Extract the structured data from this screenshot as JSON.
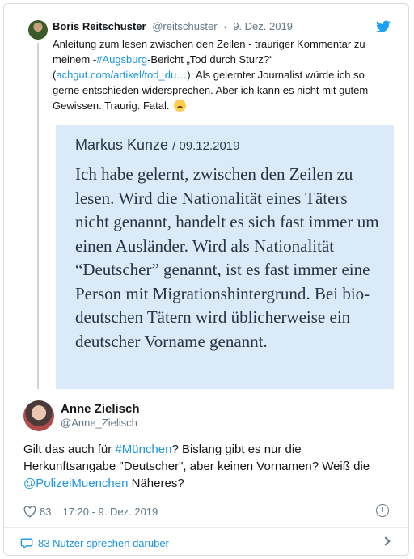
{
  "parent_tweet": {
    "name": "Boris Reitschuster",
    "handle": "@reitschuster",
    "separator": "·",
    "date": "9. Dez. 2019",
    "text_1": "Anleitung zum lesen zwischen den Zeilen - trauriger Kommentar zu meinem -",
    "hashtag": "#Augsburg",
    "text_2": "-Bericht „Tod durch Sturz?“ (",
    "link": "achgut.com/artikel/tod_du…",
    "text_3": ").  Als gelernter Journalist würde ich so gerne entschieden widersprechen. Aber ich  kann es nicht mit gutem Gewissen. Traurig. Fatal.",
    "emoji": "crying-face-icon"
  },
  "quote_image": {
    "author": "Markus Kunze",
    "date": "/ 09.12.2019",
    "body": "Ich habe gelernt, zwischen den Zeilen zu lesen. Wird die Nationalität eines Täters nicht genannt, handelt es sich fast immer um einen Ausländer. Wird als Nationalität “Deutscher” genannt, ist es fast immer eine Person mit Migrationshintergrund. Bei bio-deutschen Tätern wird üblicherweise ein deutscher Vorname genannt."
  },
  "main_tweet": {
    "name": "Anne Zielisch",
    "handle": "@Anne_Zielisch",
    "text_1": "Gilt das auch für ",
    "hashtag": "#München",
    "text_2": "? Bislang gibt es nur die Herkunftsangabe \"Deutscher\", aber keinen Vornamen? Weiß die ",
    "mention": "@PolizeiMuenchen",
    "text_3": " Näheres?",
    "likes": "83",
    "timestamp": "17:20 - 9. Dez. 2019"
  },
  "footer": {
    "conversation": "83 Nutzer sprechen darüber"
  },
  "colors": {
    "link": "#1b95e0",
    "quote_bg": "#dbeaf8",
    "muted": "#657786"
  }
}
